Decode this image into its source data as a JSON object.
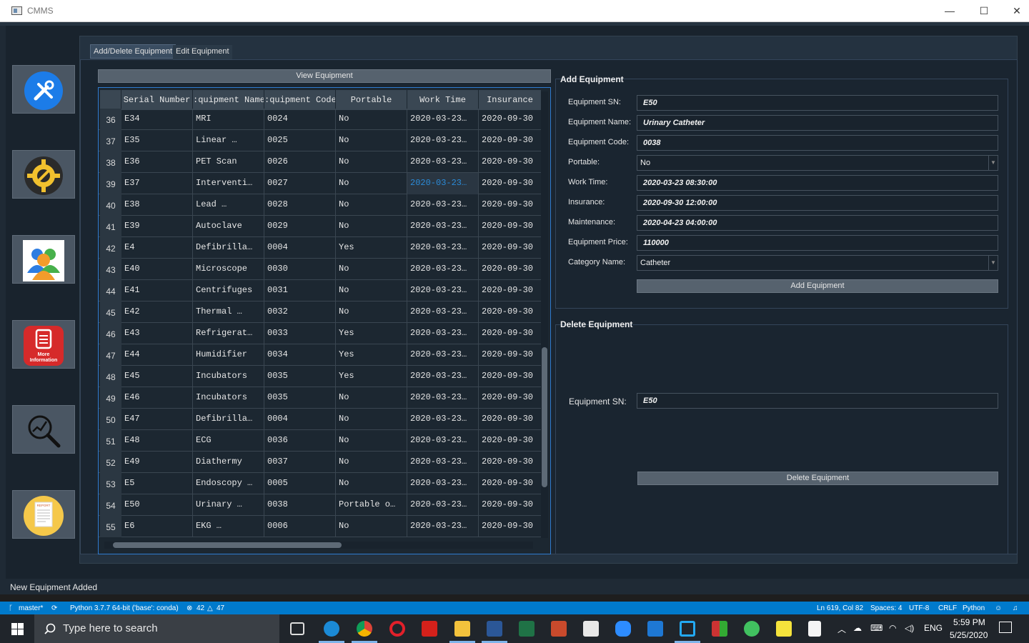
{
  "window": {
    "title": "CMMS",
    "minimize": "—",
    "maximize": "☐",
    "close": "✕"
  },
  "sidebar": {
    "buttons": [
      {
        "name": "equipment-tools",
        "icon": "tools-icon"
      },
      {
        "name": "settings",
        "icon": "gear-wrench-icon"
      },
      {
        "name": "users",
        "icon": "users-icon"
      },
      {
        "name": "more-information",
        "icon": "document-icon",
        "label": "More Information"
      },
      {
        "name": "analytics",
        "icon": "chart-magnifier-icon"
      },
      {
        "name": "report",
        "icon": "report-icon",
        "label": "REPORT"
      }
    ]
  },
  "tabs": [
    {
      "label": "Add/Delete Equipment",
      "active": true
    },
    {
      "label": "Edit Equipment",
      "active": false
    }
  ],
  "view_button": "View Equipment",
  "table": {
    "columns": [
      "Serial Number",
      "Equipment Name",
      "Equipment Code",
      "Portable",
      "Work Time",
      "Insurance"
    ],
    "columns_shown": [
      "Serial Number",
      ":quipment Name",
      ":quipment Code",
      "Portable",
      "Work Time",
      "Insurance"
    ],
    "rows": [
      {
        "n": "36",
        "sn": "E34",
        "name": "MRI",
        "code": "0024",
        "portable": "No",
        "work": "2020-03-23…",
        "ins": "2020-09-30"
      },
      {
        "n": "37",
        "sn": "E35",
        "name": "Linear …",
        "code": "0025",
        "portable": "No",
        "work": "2020-03-23…",
        "ins": "2020-09-30"
      },
      {
        "n": "38",
        "sn": "E36",
        "name": "PET Scan",
        "code": "0026",
        "portable": "No",
        "work": "2020-03-23…",
        "ins": "2020-09-30"
      },
      {
        "n": "39",
        "sn": "E37",
        "name": "Interventi…",
        "code": "0027",
        "portable": "No",
        "work": "2020-03-23…",
        "ins": "2020-09-30",
        "selected": true
      },
      {
        "n": "40",
        "sn": "E38",
        "name": "Lead …",
        "code": "0028",
        "portable": "No",
        "work": "2020-03-23…",
        "ins": "2020-09-30"
      },
      {
        "n": "41",
        "sn": "E39",
        "name": "Autoclave",
        "code": "0029",
        "portable": "No",
        "work": "2020-03-23…",
        "ins": "2020-09-30"
      },
      {
        "n": "42",
        "sn": "E4",
        "name": "Defibrilla…",
        "code": "0004",
        "portable": "Yes",
        "work": "2020-03-23…",
        "ins": "2020-09-30"
      },
      {
        "n": "43",
        "sn": "E40",
        "name": "Microscope",
        "code": "0030",
        "portable": "No",
        "work": "2020-03-23…",
        "ins": "2020-09-30"
      },
      {
        "n": "44",
        "sn": "E41",
        "name": "Centrifuges",
        "code": "0031",
        "portable": "No",
        "work": "2020-03-23…",
        "ins": "2020-09-30"
      },
      {
        "n": "45",
        "sn": "E42",
        "name": "Thermal …",
        "code": "0032",
        "portable": "No",
        "work": "2020-03-23…",
        "ins": "2020-09-30"
      },
      {
        "n": "46",
        "sn": "E43",
        "name": "Refrigerat…",
        "code": "0033",
        "portable": "Yes",
        "work": "2020-03-23…",
        "ins": "2020-09-30"
      },
      {
        "n": "47",
        "sn": "E44",
        "name": "Humidifier",
        "code": "0034",
        "portable": "Yes",
        "work": "2020-03-23…",
        "ins": "2020-09-30"
      },
      {
        "n": "48",
        "sn": "E45",
        "name": "Incubators",
        "code": "0035",
        "portable": "Yes",
        "work": "2020-03-23…",
        "ins": "2020-09-30"
      },
      {
        "n": "49",
        "sn": "E46",
        "name": "Incubators",
        "code": "0035",
        "portable": "No",
        "work": "2020-03-23…",
        "ins": "2020-09-30"
      },
      {
        "n": "50",
        "sn": "E47",
        "name": "Defibrilla…",
        "code": "0004",
        "portable": "No",
        "work": "2020-03-23…",
        "ins": "2020-09-30"
      },
      {
        "n": "51",
        "sn": "E48",
        "name": "ECG",
        "code": "0036",
        "portable": "No",
        "work": "2020-03-23…",
        "ins": "2020-09-30"
      },
      {
        "n": "52",
        "sn": "E49",
        "name": "Diathermy",
        "code": "0037",
        "portable": "No",
        "work": "2020-03-23…",
        "ins": "2020-09-30"
      },
      {
        "n": "53",
        "sn": "E5",
        "name": "Endoscopy …",
        "code": "0005",
        "portable": "No",
        "work": "2020-03-23…",
        "ins": "2020-09-30"
      },
      {
        "n": "54",
        "sn": "E50",
        "name": "Urinary …",
        "code": "0038",
        "portable": "Portable o…",
        "work": "2020-03-23…",
        "ins": "2020-09-30"
      },
      {
        "n": "55",
        "sn": "E6",
        "name": "EKG …",
        "code": "0006",
        "portable": "No",
        "work": "2020-03-23…",
        "ins": "2020-09-30"
      }
    ]
  },
  "add_equipment": {
    "title": "Add Equipment",
    "fields": [
      {
        "label": "Equipment SN:",
        "value": "E50",
        "type": "input"
      },
      {
        "label": "Equipment Name:",
        "value": "Urinary Catheter",
        "type": "input"
      },
      {
        "label": "Equipment Code:",
        "value": "0038",
        "type": "input"
      },
      {
        "label": "Portable:",
        "value": "No",
        "type": "select"
      },
      {
        "label": "Work Time:",
        "value": "2020-03-23 08:30:00",
        "type": "input"
      },
      {
        "label": "Insurance:",
        "value": "2020-09-30 12:00:00",
        "type": "input"
      },
      {
        "label": "Maintenance:",
        "value": "2020-04-23 04:00:00",
        "type": "input"
      },
      {
        "label": "Equipment Price:",
        "value": "110000",
        "type": "input"
      },
      {
        "label": "Category Name:",
        "value": "Catheter",
        "type": "select"
      }
    ],
    "button": "Add Equipment"
  },
  "delete_equipment": {
    "title": "Delete Equipment",
    "sn_label": "Equipment SN:",
    "sn_value": "E50",
    "button": "Delete Equipment"
  },
  "status_message": "New Equipment Added",
  "vscode_status": {
    "branch": "master*",
    "python": "Python 3.7.7 64-bit ('base': conda)",
    "errors": "42",
    "warnings": "47",
    "position": "Ln 619, Col 82",
    "spaces": "Spaces: 4",
    "encoding": "UTF-8",
    "eol": "CRLF",
    "language": "Python"
  },
  "taskbar": {
    "search_placeholder": "Type here to search",
    "lang": "ENG",
    "time": "5:59 PM",
    "date": "5/25/2020"
  },
  "colors": {
    "accent": "#2f7bd0",
    "selected_text": "#2b8bd8",
    "vscode_bar": "#007acc",
    "panel_bg": "#19232d"
  }
}
